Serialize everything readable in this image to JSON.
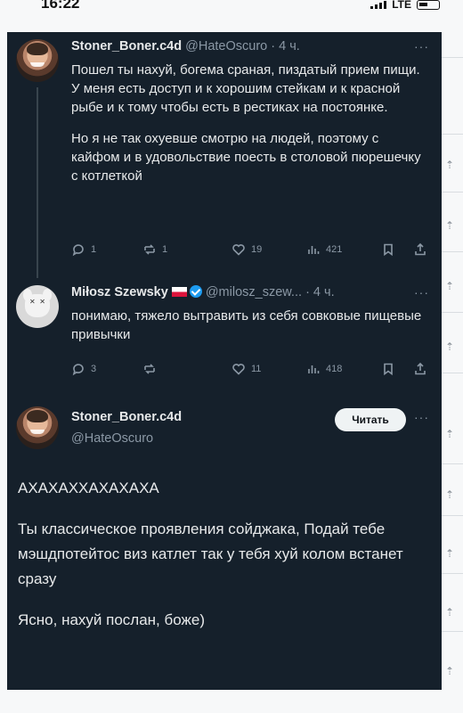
{
  "status": {
    "time": "16:22",
    "network": "LTE"
  },
  "tweets": [
    {
      "name": "Stoner_Boner.c4d",
      "handle": "@HateOscuro",
      "time": "· 4 ч.",
      "paragraphs": [
        "Пошел ты нахуй, богема сраная, пиздатый прием пищи. У меня есть доступ и к хорошим стейкам и к красной рыбе и к тому чтобы есть в рестиках на постоянке.",
        "Но я не так охуевше смотрю на людей, поэтому с кайфом и в удовольствие поесть в столовой пюрешечку с котлеткой"
      ],
      "replies": "1",
      "reposts": "1",
      "likes": "19",
      "views": "421"
    },
    {
      "name": "Miłosz Szewsky",
      "handle": "@milosz_szew...",
      "time": "· 4 ч.",
      "text": "понимаю, тяжело вытравить из себя совковые пищевые привычки",
      "replies": "3",
      "reposts": "",
      "likes": "11",
      "views": "418"
    }
  ],
  "main_tweet": {
    "name": "Stoner_Boner.c4d",
    "handle": "@HateOscuro",
    "follow_label": "Читать",
    "paragraphs": [
      "АХАХАХХАХАХАХА",
      "Ты классическое проявления сойджака, Подай тебе мэшдпотейтос виз катлет так у тебя хуй колом встанет сразу",
      "Ясно, нахуй послан, боже)"
    ]
  },
  "more_glyph": "···",
  "colors": {
    "card_bg": "#15202b",
    "text": "#e7e9ea",
    "muted": "#8b98a5",
    "verified": "#1d9bf0",
    "button_bg": "#eff3f4"
  }
}
